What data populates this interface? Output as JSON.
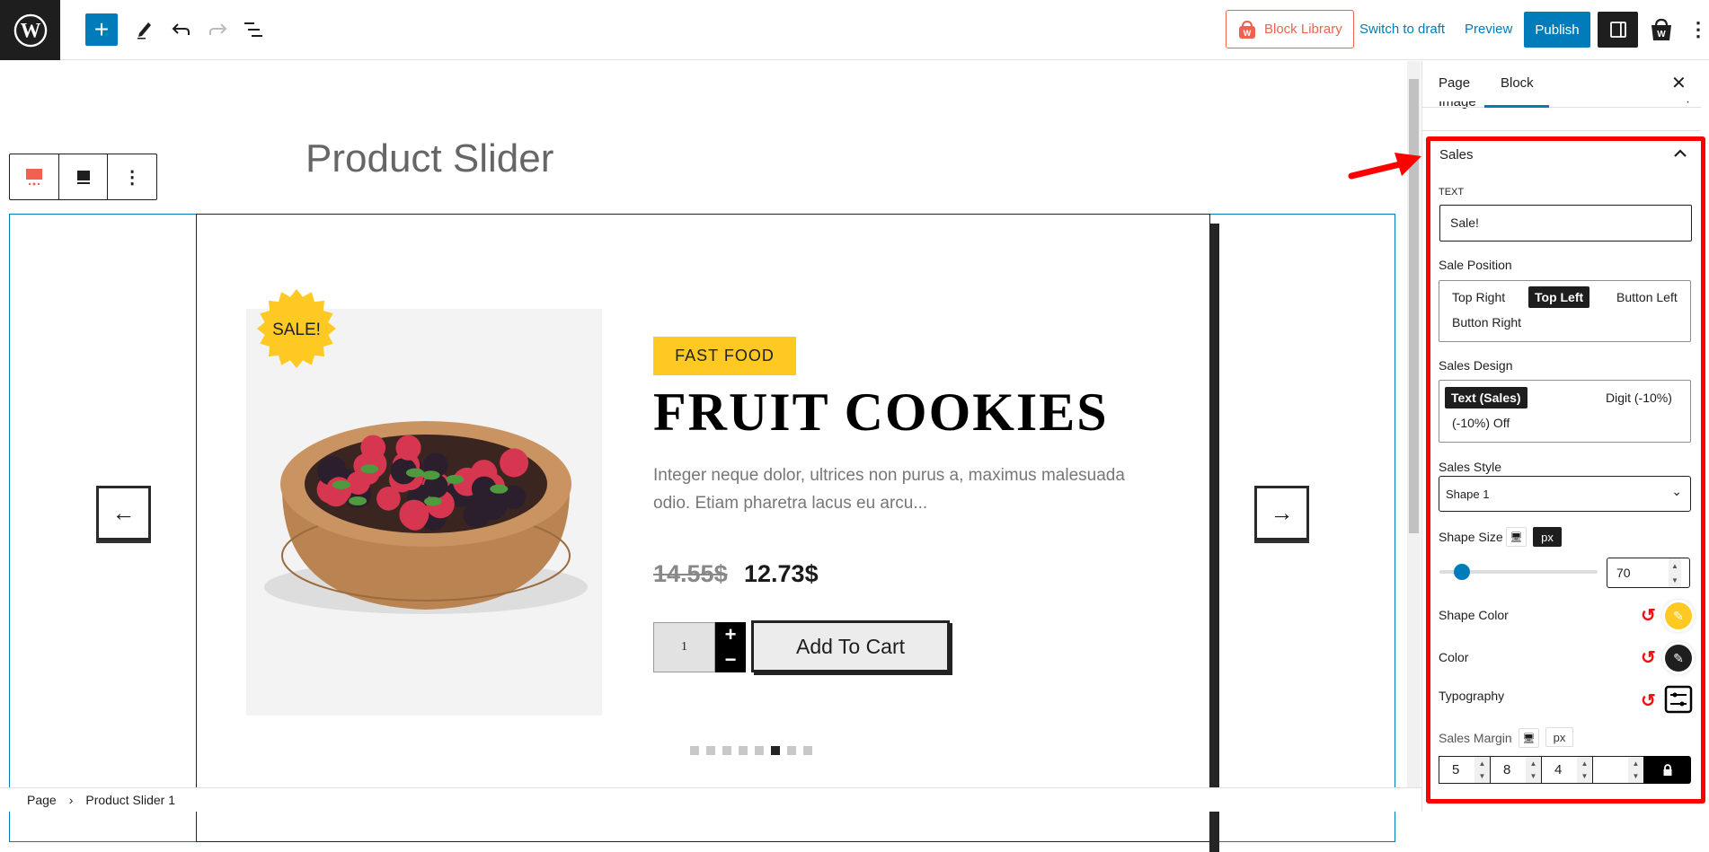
{
  "topbar": {
    "block_library": "Block Library",
    "switch_to_draft": "Switch to draft",
    "preview": "Preview",
    "publish": "Publish"
  },
  "editor": {
    "page_title": "Product Slider",
    "product": {
      "sale_badge": "SALE!",
      "category": "FAST FOOD",
      "title": "FRUIT COOKIES",
      "description": "Integer neque dolor, ultrices non purus a, maximus malesuada odio. Etiam pharetra lacus eu arcu...",
      "old_price": "14.55$",
      "new_price": "12.73$",
      "quantity": "1",
      "add_to_cart": "Add To Cart"
    },
    "prev_arrow": "←",
    "next_arrow": "→",
    "slide_count": 8,
    "active_slide": 6
  },
  "breadcrumb": [
    "Page",
    "Product Slider 1"
  ],
  "sidebar": {
    "tabs": [
      "Page",
      "Block"
    ],
    "active_tab": "Block",
    "collapsed_panel": "Image",
    "panel_title": "Sales",
    "text_label": "TEXT",
    "text_value": "Sale!",
    "sale_position_label": "Sale Position",
    "sale_positions": [
      "Top Right",
      "Top Left",
      "Button Left",
      "Button Right"
    ],
    "sale_position_selected": "Top Left",
    "sales_design_label": "Sales Design",
    "sales_designs": [
      "Text (Sales)",
      "Digit (-10%)",
      "(-10%) Off"
    ],
    "sales_design_selected": "Text (Sales)",
    "sales_style_label": "Sales Style",
    "sales_style_value": "Shape 1",
    "shape_size_label": "Shape Size",
    "shape_size_unit": "px",
    "shape_size_value": "70",
    "shape_size_slider_fraction": 0.14,
    "shape_color_label": "Shape Color",
    "shape_color": "#ffc924",
    "color_label": "Color",
    "color": "#1e1e1e",
    "typography_label": "Typography",
    "sales_margin_label": "Sales Margin",
    "sales_margin_unit": "px",
    "sales_margin_values": [
      "5",
      "8",
      "4",
      ""
    ]
  },
  "colors": {
    "accent": "#007cba",
    "highlight": "#ff0000",
    "brand": "#f0624f",
    "badge": "#ffc924"
  }
}
